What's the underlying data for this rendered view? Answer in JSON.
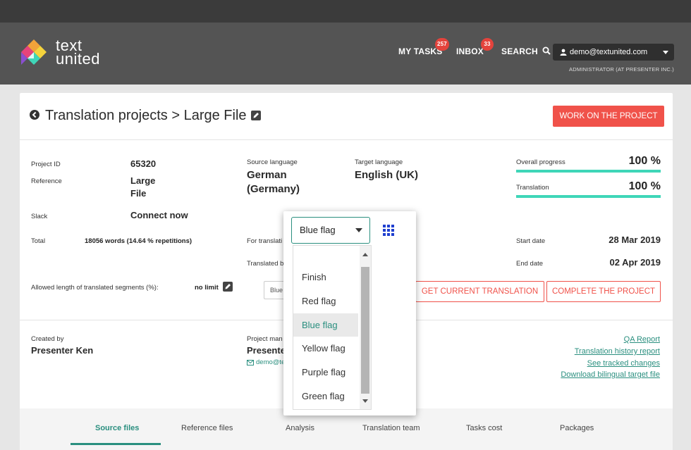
{
  "brand": {
    "line1": "text",
    "line2": "united"
  },
  "nav": {
    "my_tasks": "MY TASKS",
    "my_tasks_badge": "257",
    "inbox": "INBOX",
    "inbox_badge": "33",
    "search": "SEARCH",
    "user_email": "demo@textunited.com",
    "role": "ADMINISTRATOR (AT PRESENTER INC.)"
  },
  "page": {
    "breadcrumb": "Translation projects > Large File",
    "work_button": "WORK ON THE PROJECT"
  },
  "details": {
    "project_id_label": "Project ID",
    "project_id": "65320",
    "reference_label": "Reference",
    "reference": "Large File",
    "slack_label": "Slack",
    "slack": "Connect now",
    "total_label": "Total",
    "total": "18056 words (14.64 % repetitions)",
    "allowed_label": "Allowed length of translated segments (%):",
    "allowed": "no limit",
    "source_label": "Source language",
    "source": "German (Germany)",
    "target_label": "Target language",
    "target": "English (UK)",
    "for_transl_label": "For translati",
    "translated_by_label": "Translated b",
    "mini_select": "Blue"
  },
  "progress": {
    "overall_label": "Overall progress",
    "overall": "100 %",
    "overall_value": 100,
    "translation_label": "Translation",
    "translation": "100 %",
    "translation_value": 100,
    "start_label": "Start date",
    "start": "28 Mar 2019",
    "end_label": "End date",
    "end": "02 Apr 2019"
  },
  "actions": {
    "get_translation": "GET CURRENT TRANSLATION",
    "complete": "COMPLETE THE PROJECT"
  },
  "people": {
    "created_label": "Created by",
    "created": "Presenter Ken",
    "pm_label": "Project man",
    "pm": "Presenter",
    "pm_email": "demo@te"
  },
  "links": {
    "qa": "QA Report",
    "history": "Translation history report",
    "tracked": "See tracked changes",
    "bilingual": "Download bilingual target file"
  },
  "tabs": [
    "Source files",
    "Reference files",
    "Analysis",
    "Translation team",
    "Tasks cost",
    "Packages"
  ],
  "dropdown": {
    "selected": "Blue flag",
    "options": [
      "Finish",
      "Red flag",
      "Blue flag",
      "Yellow flag",
      "Purple flag",
      "Green flag"
    ]
  },
  "colors": {
    "accent": "#f0524a",
    "teal": "#2a8f7f",
    "progress": "#3fd6b8",
    "header": "#545454"
  }
}
